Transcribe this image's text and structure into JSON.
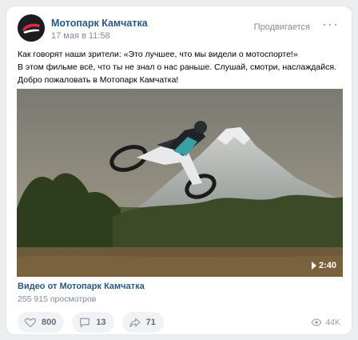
{
  "post": {
    "author": "Мотопарк Камчатка",
    "date": "17 мая в 11:58",
    "promoted_label": "Продвигается",
    "more_label": "···",
    "text_lines": [
      "Как говорят наши зрители: «Это лучшее, что мы видели о мотоспорте!»",
      "В этом фильме всё, что ты не знал о нас раньше. Слушай, смотри, наслаждайся.",
      "Добро пожаловать в Мотопарк Камчатка!"
    ]
  },
  "video": {
    "duration": "2:40",
    "title": "Видео от Мотопарк Камчатка",
    "views": "255 915 просмотров"
  },
  "actions": {
    "likes": "800",
    "comments": "13",
    "shares": "71",
    "views": "44K"
  },
  "icons": [
    "heart-icon",
    "comment-icon",
    "share-icon",
    "eye-icon",
    "play-icon",
    "more-icon"
  ],
  "colors": {
    "link": "#2a5885",
    "secondary": "#818c99",
    "button_bg": "#f0f2f5"
  }
}
